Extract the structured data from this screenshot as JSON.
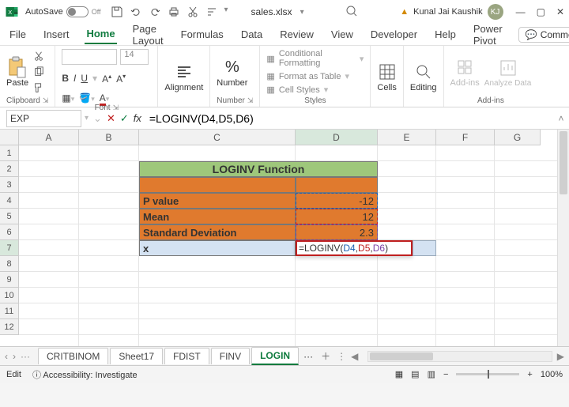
{
  "titlebar": {
    "autosave_label": "AutoSave",
    "autosave_state": "Off",
    "filename": "sales.xlsx",
    "user_name": "Kunal Jai Kaushik",
    "user_initials": "KJ"
  },
  "tabs": {
    "file": "File",
    "insert": "Insert",
    "home": "Home",
    "page_layout": "Page Layout",
    "formulas": "Formulas",
    "data": "Data",
    "review": "Review",
    "view": "View",
    "developer": "Developer",
    "help": "Help",
    "power_pivot": "Power Pivot",
    "comments": "Comments"
  },
  "ribbon": {
    "clipboard": {
      "paste": "Paste",
      "label": "Clipboard"
    },
    "font": {
      "label": "Font",
      "size": "14",
      "buttons": {
        "bold": "B",
        "italic": "I",
        "underline": "U"
      }
    },
    "alignment": {
      "big": "Alignment"
    },
    "number": {
      "big": "Number",
      "label": "Number"
    },
    "styles": {
      "cond": "Conditional Formatting",
      "table": "Format as Table",
      "cell": "Cell Styles",
      "label": "Styles"
    },
    "cells": {
      "big": "Cells"
    },
    "editing": {
      "big": "Editing"
    },
    "addins": {
      "big": "Add-ins",
      "analyze": "Analyze Data",
      "label": "Add-ins"
    }
  },
  "formula_bar": {
    "namebox": "EXP",
    "formula": "=LOGINV(D4,D5,D6)"
  },
  "columns": [
    "A",
    "B",
    "C",
    "D",
    "E",
    "F",
    "G"
  ],
  "rows": [
    "1",
    "2",
    "3",
    "4",
    "5",
    "6",
    "7",
    "8",
    "9",
    "10",
    "11",
    "12"
  ],
  "sheet": {
    "title": "LOGINV Function",
    "r4": {
      "label": "P value",
      "value": "-12"
    },
    "r5": {
      "label": "Mean",
      "value": "12"
    },
    "r6": {
      "label": "Standard Deviation",
      "value": "2.3"
    },
    "r7": {
      "label": "x",
      "formula_prefix": "=LOGINV(",
      "ref1": "D4",
      "ref2": "D5",
      "ref3": "D6",
      "close": ")"
    }
  },
  "sheet_tabs": {
    "t1": "CRITBINOM",
    "t2": "Sheet17",
    "t3": "FDIST",
    "t4": "FINV",
    "t5": "LOGIN",
    "more": "···"
  },
  "status": {
    "mode": "Edit",
    "accessibility": "Accessibility: Investigate",
    "zoom": "100%"
  }
}
